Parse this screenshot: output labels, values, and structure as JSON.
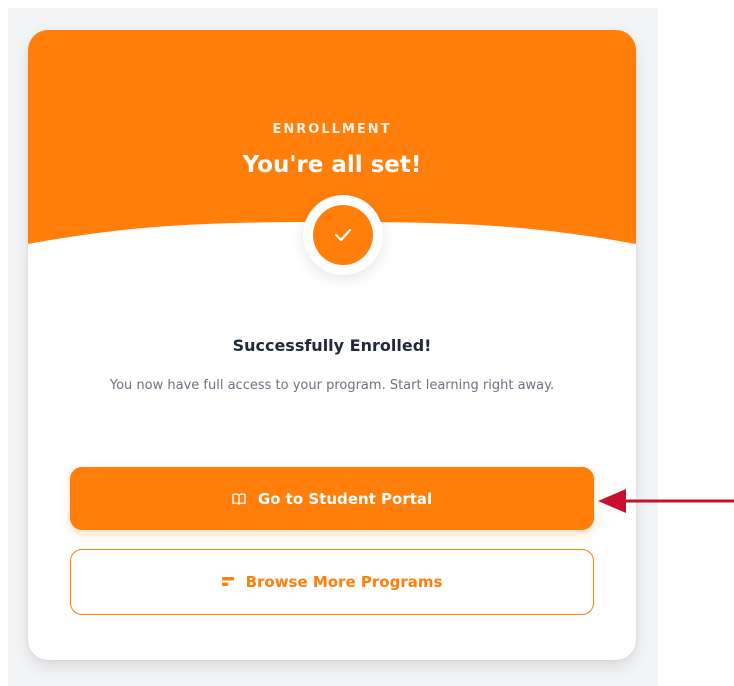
{
  "header": {
    "eyebrow": "ENROLLMENT",
    "title": "You're all set!"
  },
  "status": {
    "title": "Successfully Enrolled!",
    "description": "You now have full access to your program. Start learning right away."
  },
  "actions": {
    "primary": {
      "label": "Go to Student Portal",
      "icon": "book-open-icon"
    },
    "secondary": {
      "label": "Browse More Programs",
      "icon": "catalog-icon"
    }
  },
  "icons": {
    "status": "checkmark-icon",
    "annotation": "red-arrow-pointer"
  },
  "colors": {
    "accent": "#ff7f0a",
    "annotation_arrow": "#c8102e",
    "title_text": "#1f2937",
    "body_text": "#6b7280"
  }
}
